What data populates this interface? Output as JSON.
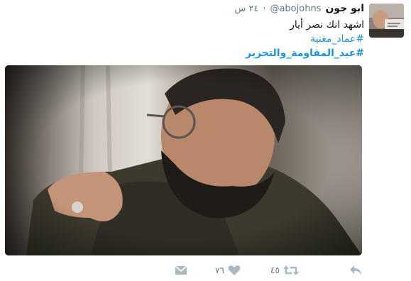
{
  "tweet": {
    "author_name": "ابو جون",
    "author_handle": "@abojohns",
    "separator": "·",
    "time": "٢٤ س",
    "lines": [
      {
        "text": "اشهد انك نصر أيار",
        "type": "plain"
      },
      {
        "text": "#عماد_مغنية",
        "type": "hashtag"
      },
      {
        "text": "#عيد_المقاومة_والتحرير",
        "type": "hashtag-bold"
      }
    ],
    "avatar_alt": "avatar"
  },
  "actions": {
    "reply_icon": "reply-icon",
    "retweet_icon": "retweet-icon",
    "retweet_count": "٤٥",
    "like_icon": "heart-icon",
    "like_count": "٧٦",
    "dm_icon": "direct-message-icon"
  },
  "colors": {
    "link": "#1b95e0",
    "muted": "#657786",
    "icon": "#aab8c2"
  }
}
